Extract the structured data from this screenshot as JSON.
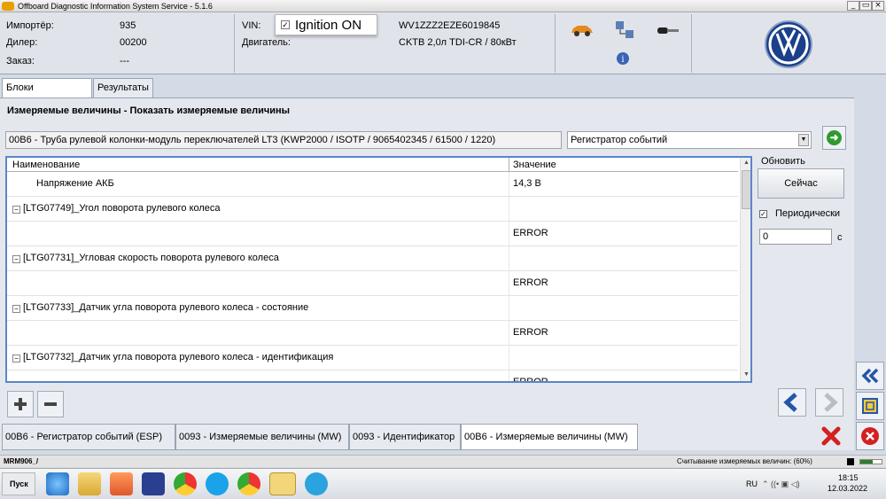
{
  "window": {
    "title": "Offboard Diagnostic Information System Service - 5.1.6",
    "controls": [
      "_",
      "▭",
      "×"
    ]
  },
  "header": {
    "importer_label": "Импортёр:",
    "importer_value": "935",
    "dealer_label": "Дилер:",
    "dealer_value": "00200",
    "order_label": "Заказ:",
    "order_value": "---",
    "vin_label": "VIN:",
    "vin_value": "WV1ZZZ2EZE6019845",
    "engine_label": "Двигатель:",
    "engine_value": "CKTB 2,0л TDI-CR / 80кВт",
    "ignition_label": "Ignition ON",
    "ignition_checked": true,
    "icons": [
      "car-icon",
      "network-icon",
      "key-icon",
      "info-icon"
    ],
    "brand_logo": "vw-logo"
  },
  "tabs": [
    {
      "label": "Блоки управления",
      "active": true
    },
    {
      "label": "Результаты",
      "active": false
    }
  ],
  "page_title": "Измеряемые величины - Показать измеряемые величины",
  "module_text": "00B6 - Труба рулевой колонки-модуль переключателей LT3  (KWP2000 / ISOTP / 9065402345 / 61500 / 1220)",
  "select_value": "Регистратор событий",
  "table": {
    "col_name": "Наименование",
    "col_value": "Значение",
    "rows": [
      {
        "name": "Напряжение АКБ",
        "value": "14,3 В",
        "group": false
      },
      {
        "name": "[LTG07749]_Угол поворота рулевого колеса",
        "value": "",
        "group": true
      },
      {
        "name": "",
        "value": "ERROR",
        "group": false
      },
      {
        "name": "[LTG07731]_Угловая скорость поворота рулевого колеса",
        "value": "",
        "group": true
      },
      {
        "name": "",
        "value": "ERROR",
        "group": false
      },
      {
        "name": "[LTG07733]_Датчик угла поворота рулевого колеса - состояние",
        "value": "",
        "group": true
      },
      {
        "name": "",
        "value": "ERROR",
        "group": false
      },
      {
        "name": "[LTG07732]_Датчик угла поворота рулевого колеса - идентификация",
        "value": "",
        "group": true
      },
      {
        "name": "",
        "value": "ERROR",
        "group": false
      }
    ]
  },
  "refresh": {
    "label": "Обновить",
    "now_button": "Сейчас",
    "periodic_label": "Периодически",
    "periodic_checked": true,
    "interval_value": "0",
    "interval_unit": "с"
  },
  "bottom_tabs": [
    {
      "label": "00B6 - Регистратор событий (ESP)",
      "active": false
    },
    {
      "label": "0093 - Измеряемые величины (MW)",
      "active": false
    },
    {
      "label": "0093 - Идентификатор",
      "active": false
    },
    {
      "label": "00B6 - Измеряемые величины (MW)",
      "active": true
    }
  ],
  "statusbar": {
    "left": "MRM906_/",
    "right": "Считывание измеряемых величин: (60%)",
    "progress_percent": 60
  },
  "taskbar": {
    "start_label": "Пуск",
    "lang": "RU",
    "time": "18:15",
    "date": "12.03.2022",
    "apps": [
      "ie-icon",
      "explorer-icon",
      "media-icon",
      "save-icon",
      "chrome-icon",
      "skype-icon",
      "chrome2-icon",
      "odis-icon",
      "telegram-icon"
    ]
  },
  "colors": {
    "accent_blue": "#2456a8",
    "go_green": "#2f9a2f",
    "close_red": "#d32020"
  }
}
